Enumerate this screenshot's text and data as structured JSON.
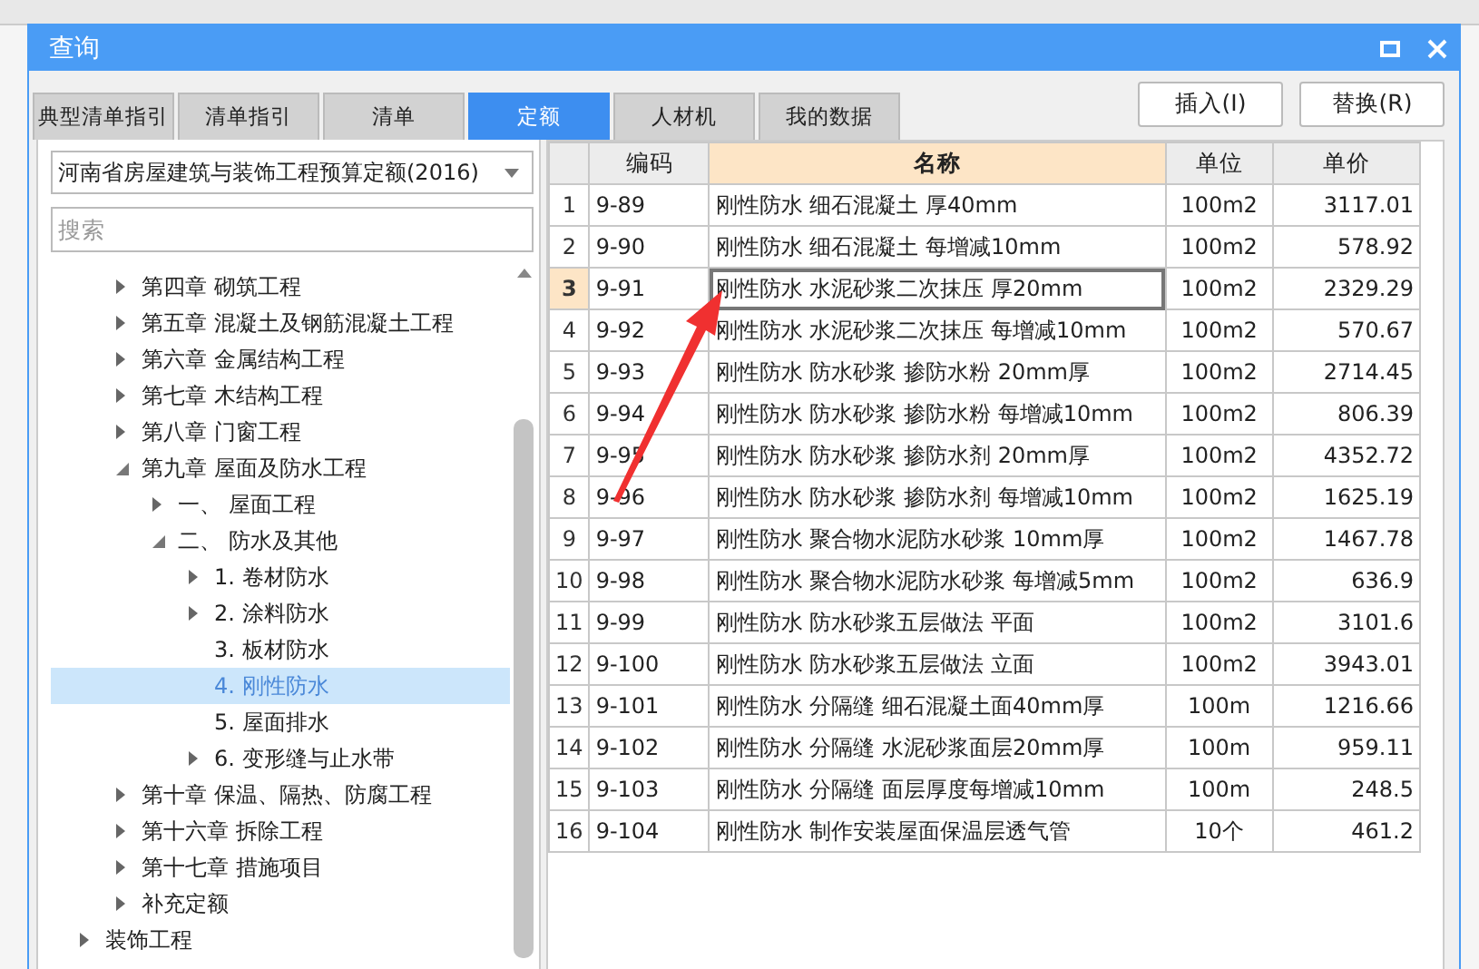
{
  "window": {
    "title": "查询"
  },
  "tabs": [
    {
      "label": "典型清单指引",
      "selected": false
    },
    {
      "label": "清单指引",
      "selected": false
    },
    {
      "label": "清单",
      "selected": false
    },
    {
      "label": "定额",
      "selected": true
    },
    {
      "label": "人材机",
      "selected": false
    },
    {
      "label": "我的数据",
      "selected": false
    }
  ],
  "buttons": [
    "插入(I)",
    "替换(R)"
  ],
  "library_select": {
    "value": "河南省房屋建筑与装饰工程预算定额(2016)"
  },
  "search": {
    "placeholder": "搜索"
  },
  "tree": {
    "items": [
      {
        "children": [
          {
            "label": "第四章 砌筑工程",
            "expanded": false,
            "selected": false
          },
          {
            "label": "第五章 混凝土及钢筋混凝土工程",
            "expanded": false,
            "selected": false
          },
          {
            "label": "第六章 金属结构工程",
            "expanded": false,
            "selected": false
          },
          {
            "label": "第七章 木结构工程",
            "expanded": false,
            "selected": false
          },
          {
            "label": "第八章 门窗工程",
            "expanded": false,
            "selected": false
          },
          {
            "label": "第九章 屋面及防水工程",
            "expanded": true,
            "selected": false,
            "children": [
              {
                "label": "一、 屋面工程",
                "expanded": false,
                "selected": false
              },
              {
                "label": "二、 防水及其他",
                "expanded": true,
                "selected": false,
                "children": [
                  {
                    "label": "1. 卷材防水",
                    "expanded": false,
                    "selected": false
                  },
                  {
                    "label": "2. 涂料防水",
                    "expanded": false,
                    "selected": false
                  },
                  {
                    "label": "3. 板材防水",
                    "selected": false
                  },
                  {
                    "label": "4. 刚性防水",
                    "selected": true
                  },
                  {
                    "label": "5. 屋面排水",
                    "selected": false
                  },
                  {
                    "label": "6. 变形缝与止水带",
                    "expanded": false,
                    "selected": false
                  }
                ]
              }
            ]
          },
          {
            "label": "第十章 保温、隔热、防腐工程",
            "expanded": false,
            "selected": false
          },
          {
            "label": "第十六章 拆除工程",
            "expanded": false,
            "selected": false
          },
          {
            "label": "第十七章 措施项目",
            "expanded": false,
            "selected": false
          },
          {
            "label": "补充定额",
            "expanded": false,
            "selected": false
          }
        ]
      },
      {
        "label": "装饰工程",
        "expanded": false,
        "selected": false
      }
    ]
  },
  "table": {
    "columns": [
      {
        "label": "编码",
        "selected": false
      },
      {
        "label": "名称",
        "selected": true
      },
      {
        "label": "单位",
        "selected": false
      },
      {
        "label": "单价",
        "selected": false
      }
    ],
    "rows": [
      {
        "num": "1",
        "code": "9-89",
        "name": "刚性防水  细石混凝土  厚40mm",
        "unit": "100m2",
        "price": "3117.01",
        "selected": false
      },
      {
        "num": "2",
        "code": "9-90",
        "name": "刚性防水  细石混凝土  每增减10mm",
        "unit": "100m2",
        "price": "578.92",
        "selected": false
      },
      {
        "num": "3",
        "code": "9-91",
        "name": "刚性防水  水泥砂浆二次抹压  厚20mm",
        "unit": "100m2",
        "price": "2329.29",
        "selected": true
      },
      {
        "num": "4",
        "code": "9-92",
        "name": "刚性防水  水泥砂浆二次抹压  每增减10mm",
        "unit": "100m2",
        "price": "570.67",
        "selected": false
      },
      {
        "num": "5",
        "code": "9-93",
        "name": "刚性防水  防水砂浆  掺防水粉  20mm厚",
        "unit": "100m2",
        "price": "2714.45",
        "selected": false
      },
      {
        "num": "6",
        "code": "9-94",
        "name": "刚性防水  防水砂浆  掺防水粉  每增减10mm",
        "unit": "100m2",
        "price": "806.39",
        "selected": false
      },
      {
        "num": "7",
        "code": "9-95",
        "name": "刚性防水  防水砂浆  掺防水剂  20mm厚",
        "unit": "100m2",
        "price": "4352.72",
        "selected": false
      },
      {
        "num": "8",
        "code": "9-96",
        "name": "刚性防水  防水砂浆  掺防水剂  每增减10mm",
        "unit": "100m2",
        "price": "1625.19",
        "selected": false
      },
      {
        "num": "9",
        "code": "9-97",
        "name": "刚性防水  聚合物水泥防水砂浆  10mm厚",
        "unit": "100m2",
        "price": "1467.78",
        "selected": false
      },
      {
        "num": "10",
        "code": "9-98",
        "name": "刚性防水  聚合物水泥防水砂浆  每增减5mm",
        "unit": "100m2",
        "price": "636.9",
        "selected": false
      },
      {
        "num": "11",
        "code": "9-99",
        "name": "刚性防水  防水砂浆五层做法  平面",
        "unit": "100m2",
        "price": "3101.6",
        "selected": false
      },
      {
        "num": "12",
        "code": "9-100",
        "name": "刚性防水  防水砂浆五层做法  立面",
        "unit": "100m2",
        "price": "3943.01",
        "selected": false
      },
      {
        "num": "13",
        "code": "9-101",
        "name": "刚性防水  分隔缝  细石混凝土面40mm厚",
        "unit": "100m",
        "price": "1216.66",
        "selected": false
      },
      {
        "num": "14",
        "code": "9-102",
        "name": "刚性防水  分隔缝  水泥砂浆面层20mm厚",
        "unit": "100m",
        "price": "959.11",
        "selected": false
      },
      {
        "num": "15",
        "code": "9-103",
        "name": "刚性防水  分隔缝  面层厚度每增减10mm",
        "unit": "100m",
        "price": "248.5",
        "selected": false
      },
      {
        "num": "16",
        "code": "9-104",
        "name": "刚性防水  制作安装屋面保温层透气管",
        "unit": "10个",
        "price": "461.2",
        "selected": false
      }
    ]
  }
}
